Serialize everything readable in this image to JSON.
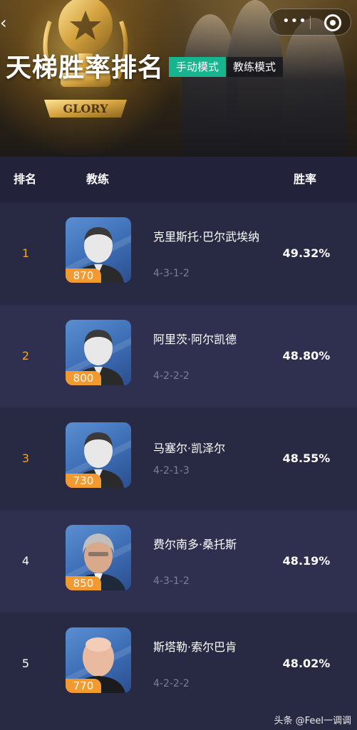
{
  "header": {
    "title": "天梯胜率排名",
    "trophy_text": "GLORY",
    "modes": [
      {
        "label": "手动模式",
        "active": true
      },
      {
        "label": "教练模式",
        "active": false
      }
    ]
  },
  "columns": {
    "rank": "排名",
    "coach": "教练",
    "win_rate": "胜率"
  },
  "rows": [
    {
      "rank": "1",
      "name": "克里斯托·巴尔武埃纳",
      "formation": "4-3-1-2",
      "score": "870",
      "rate": "49.32%",
      "avatar": "default-silhouette"
    },
    {
      "rank": "2",
      "name": "阿里茨·阿尔凯德",
      "formation": "4-2-2-2",
      "score": "800",
      "rate": "48.80%",
      "avatar": "default-silhouette"
    },
    {
      "rank": "3",
      "name": "马塞尔·凯泽尔",
      "formation": "4-2-1-3",
      "score": "730",
      "rate": "48.55%",
      "avatar": "default-silhouette"
    },
    {
      "rank": "4",
      "name": "费尔南多·桑托斯",
      "formation": "4-3-1-2",
      "score": "850",
      "rate": "48.19%",
      "avatar": "grey-hair-coach"
    },
    {
      "rank": "5",
      "name": "斯塔勒·索尔巴肯",
      "formation": "4-2-2-2",
      "score": "770",
      "rate": "48.02%",
      "avatar": "bald-coach"
    }
  ],
  "watermark": "头条 @Feel一调调",
  "colors": {
    "accent_rank": "#f0a13c",
    "active_mode": "#16b58f",
    "badge": "#f29a32"
  }
}
